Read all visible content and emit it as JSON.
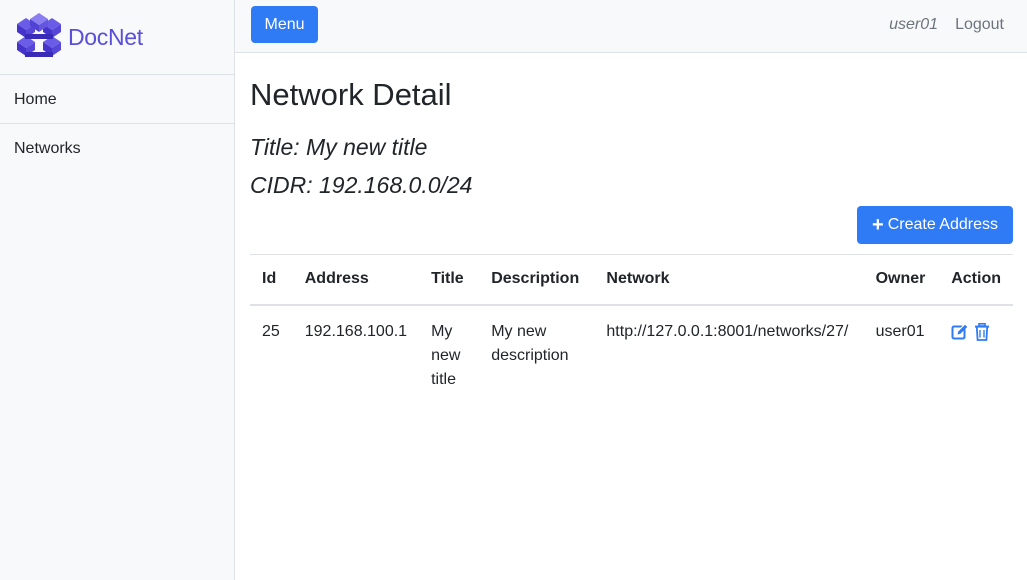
{
  "brand": {
    "name": "DocNet",
    "color": "#5a4fd8"
  },
  "sidebar": {
    "items": [
      {
        "label": "Home"
      },
      {
        "label": "Networks"
      }
    ]
  },
  "topbar": {
    "menu_label": "Menu",
    "user": "user01",
    "logout_label": "Logout"
  },
  "page": {
    "title": "Network Detail",
    "network_title": "Title: My new title",
    "network_cidr": "CIDR: 192.168.0.0/24",
    "create_button_label": "Create Address"
  },
  "table": {
    "headers": [
      "Id",
      "Address",
      "Title",
      "Description",
      "Network",
      "Owner",
      "Action"
    ],
    "rows": [
      {
        "id": "25",
        "address": "192.168.100.1",
        "title": "My new title",
        "description": "My new description",
        "network": "http://127.0.0.1:8001/networks/27/",
        "owner": "user01",
        "actions": [
          "edit-icon",
          "trash-icon"
        ]
      }
    ]
  },
  "colors": {
    "primary": "#2f7bf5",
    "sidebar_bg": "#f8f9fa",
    "muted": "#6c757d"
  }
}
